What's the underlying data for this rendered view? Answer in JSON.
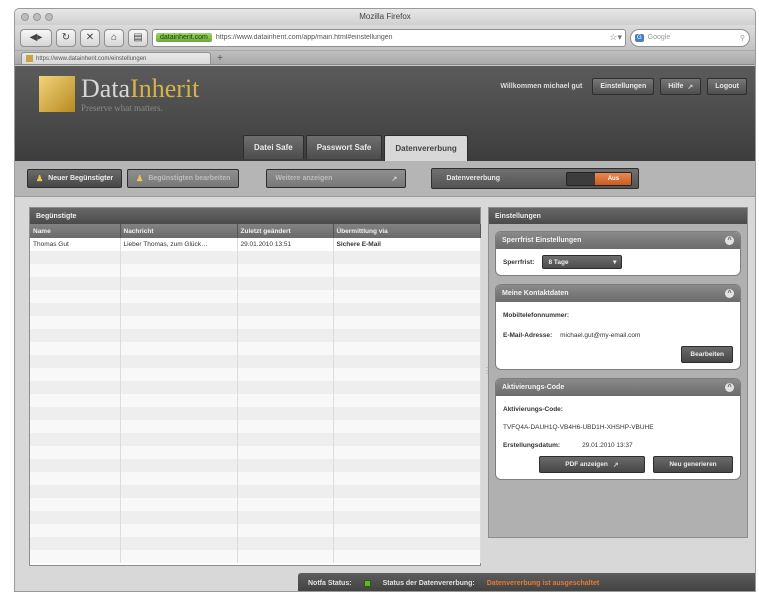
{
  "browser": {
    "title": "Mozilla Firefox",
    "ssl_badge": "datainherit.com",
    "url": "https://www.datainherit.com/app/main.html#einstellungen",
    "search_placeholder": "Google",
    "search_engine": "G",
    "tab_label": "https://www.datainherit.com/einstellungen",
    "new_tab": "+"
  },
  "app": {
    "logo_name_1": "Data",
    "logo_name_2": "Inherit",
    "logo_tagline": "Preserve what matters.",
    "welcome": "Willkommen michael gut",
    "settings_button": "Einstellungen",
    "help_button": "Hilfe",
    "logout_button": "Logout",
    "tabs": [
      {
        "label": "Datei Safe"
      },
      {
        "label": "Passwort Safe"
      },
      {
        "label": "Datenvererbung",
        "active": true
      }
    ]
  },
  "toolbar": {
    "new_recipient": "Neuer Begünstigter",
    "edit_recipient": "Begünstigten bearbeiten",
    "test_button": "Weitere anzeigen",
    "toggle_label": "Datenvererbung",
    "toggle_state": "Aus"
  },
  "recipients": {
    "panel_title": "Begünstigte",
    "columns": [
      "Name",
      "Nachricht",
      "Zuletzt geändert",
      "Übermittlung via"
    ],
    "rows": [
      {
        "name": "Thomas Gut",
        "message": "Lieber Thomas, zum Glück…",
        "changed": "29.01.2010 13:51",
        "via": "Sichere E-Mail"
      }
    ]
  },
  "settings": {
    "panel_title": "Einstellungen",
    "lock": {
      "title": "Sperrfrist Einstellungen",
      "label": "Sperrfrist:",
      "value": "8 Tage"
    },
    "contact": {
      "title": "Meine Kontaktdaten",
      "mobile_label": "Mobiltelefonnummer:",
      "mobile_value": "",
      "email_label": "E-Mail-Adresse:",
      "email_value": "michael.gut@my-email.com",
      "edit_button": "Bearbeiten"
    },
    "activation": {
      "title": "Aktivierungs-Code",
      "code_label": "Aktivierungs-Code:",
      "code_value": "TVFQ4A-DAUH1Q-VB4H6-UBD1H-XHSHP-VBUHE",
      "date_label": "Erstellungsdatum:",
      "date_value": "29.01.2010 13:37",
      "pdf_button": "PDF anzeigen",
      "regen_button": "Neu generieren"
    }
  },
  "status": {
    "label": "Notfa Status:",
    "inheritance_label": "Status der Datenvererbung:",
    "inheritance_value": "Datenvererbung ist ausgeschaltet"
  },
  "colors": {
    "accent_gold": "#d7b24a",
    "toggle_off": "#c95b22",
    "status_ok": "#62b32d",
    "status_warn": "#e27a34"
  }
}
